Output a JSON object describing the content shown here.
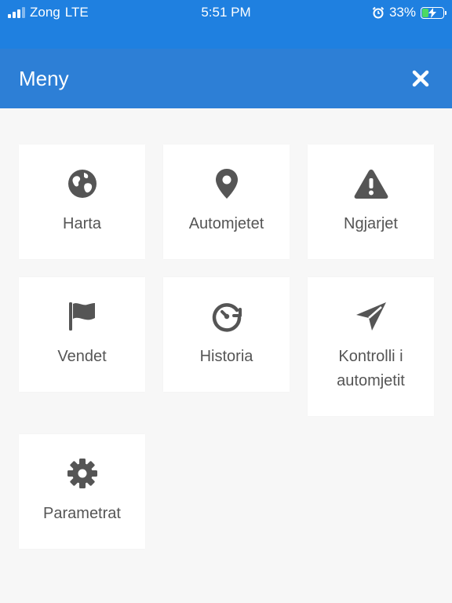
{
  "status_bar": {
    "carrier": "Zong",
    "network": "LTE",
    "time": "5:51 PM",
    "battery_percent": "33%",
    "battery_level": 0.33
  },
  "header": {
    "title": "Meny"
  },
  "menu": {
    "items": [
      {
        "label": "Harta",
        "icon": "globe-icon"
      },
      {
        "label": "Automjetet",
        "icon": "map-pin-icon"
      },
      {
        "label": "Ngjarjet",
        "icon": "warning-icon"
      },
      {
        "label": "Vendet",
        "icon": "flag-icon"
      },
      {
        "label": "Historia",
        "icon": "history-clock-icon"
      },
      {
        "label": "Kontrolli i automjetit",
        "icon": "paper-plane-icon"
      },
      {
        "label": "Parametrat",
        "icon": "gear-icon"
      }
    ]
  },
  "colors": {
    "status_bar": "#1f80e0",
    "header": "#2d7fd6",
    "background": "#f7f7f7",
    "icon": "#555555",
    "battery": "#4cd964"
  }
}
